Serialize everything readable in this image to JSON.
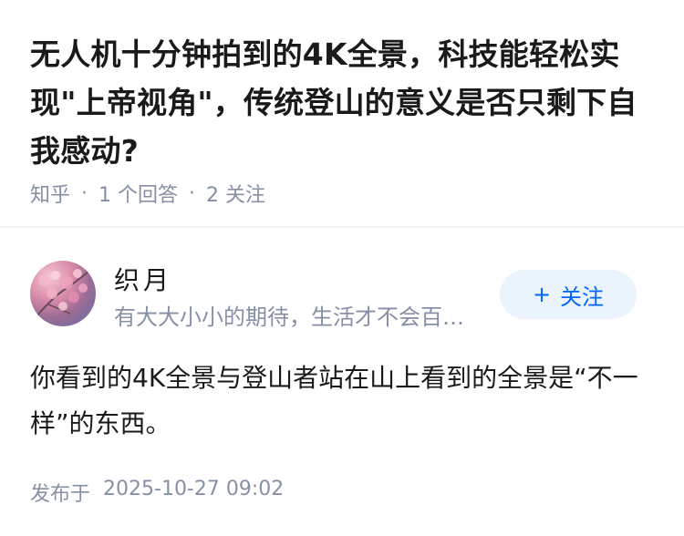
{
  "question": {
    "title": "无人机十分钟拍到的4K全景，科技能轻松实现\"上帝视角\"，传统登山的意义是否只剩下自我感动?",
    "source": "知乎",
    "separator": "·",
    "answer_count": "1 个回答",
    "follow_count": "2 关注"
  },
  "answer": {
    "author": {
      "name": "织月",
      "bio": "有大大小小的期待，生活才不会百…",
      "avatar_icon": "cherry-blossom-avatar"
    },
    "follow_button": {
      "plus": "+",
      "label": "关注"
    },
    "content": "你看到的4K全景与登山者站在山上看到的全景是“不一样”的东西。",
    "publish_label": "发布于",
    "publish_time": "2025-10-27 09:02"
  },
  "colors": {
    "meta_gray": "#8590a6",
    "accent_blue": "#0066ff",
    "follow_bg": "#ebf4fd"
  }
}
